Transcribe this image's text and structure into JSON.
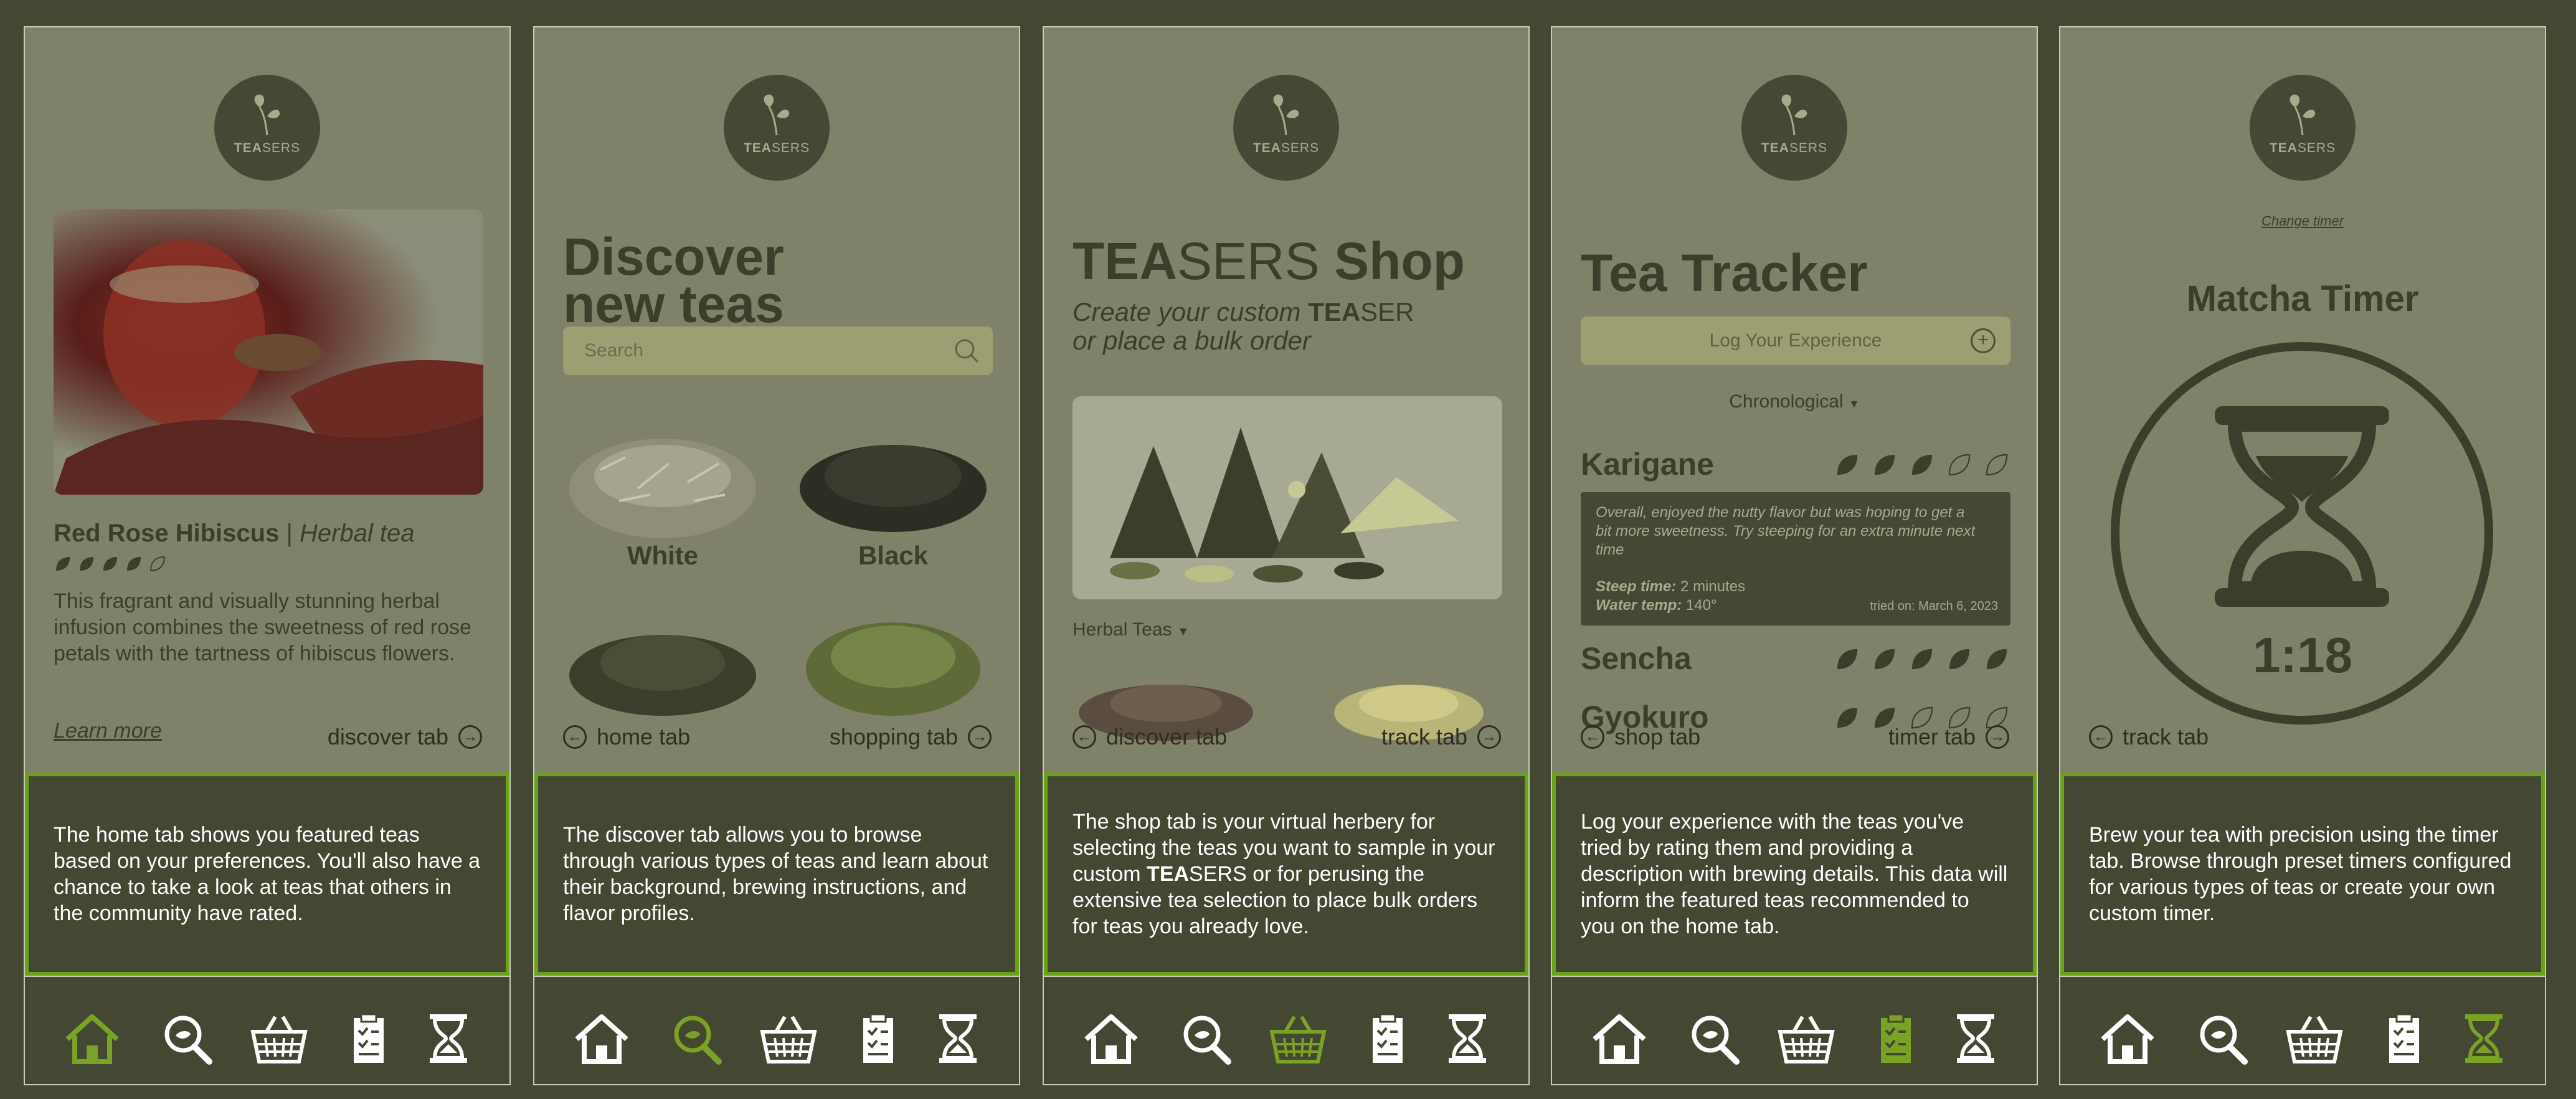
{
  "brand": {
    "logo_text_bold": "TEA",
    "logo_text_light": "SERS"
  },
  "colors": {
    "background": "#444732",
    "screen": "#7f8169",
    "accent": "#69a31a",
    "text_dark": "#3b3e2b",
    "white": "#ffffff"
  },
  "tabbar": {
    "icons": [
      "home-icon",
      "discover-search-icon",
      "shop-basket-icon",
      "tracker-clipboard-icon",
      "timer-hourglass-icon"
    ]
  },
  "panels": [
    {
      "tea_name": "Red Rose Hibiscus",
      "separator": "|",
      "tea_type": "Herbal tea",
      "rating": 4,
      "rating_max": 5,
      "body": "This fragrant and visually stunning herbal infusion combines the sweetness of red rose petals with the tartness of hibiscus flowers.",
      "learn_more": "Learn more",
      "nav_right": "discover tab",
      "description": "The home tab shows you featured teas based on your preferences. You'll also have a chance to take a look at teas that others in the community have rated.",
      "active_tab": "home"
    },
    {
      "title_line1": "Discover",
      "title_line2": "new teas",
      "search_placeholder": "Search",
      "categories": [
        "White",
        "Black"
      ],
      "nav_left": "home tab",
      "nav_right": "shopping tab",
      "description": "The discover tab allows you to browse through various types of teas and learn about their background, brewing instructions, and flavor profiles.",
      "active_tab": "discover"
    },
    {
      "title_bold": "TEA",
      "title_light": "SERS",
      "title_shop": " Shop",
      "subtitle_pre": "Create your custom ",
      "subtitle_bold": "TEA",
      "subtitle_light": "SER",
      "subtitle_line2": "or place a bulk order",
      "filter": "Herbal Teas",
      "nav_left": "discover tab",
      "nav_right": "track tab",
      "description_pre": "The shop tab is your virtual herbery for selecting the teas you want to sample in your custom ",
      "description_bold": "TEA",
      "description_post": "SERS or for perusing the extensive tea selection to place bulk orders for teas you already love.",
      "active_tab": "shop"
    },
    {
      "title": "Tea Tracker",
      "log_button": "Log Your Experience",
      "sort": "Chronological",
      "entries": [
        {
          "name": "Karigane",
          "rating": 3
        },
        {
          "name": "Sencha",
          "rating": 5
        },
        {
          "name": "Gyokuro",
          "rating": 2
        }
      ],
      "note": "Overall, enjoyed the nutty flavor but was hoping to get a bit more sweetness. Try steeping for an extra minute next time",
      "steep_label": "Steep time:",
      "steep_value": "2 minutes",
      "temp_label": "Water temp:",
      "temp_value": "140°",
      "tried_on": "tried on: March 6, 2023",
      "nav_left": "shop tab",
      "nav_right": "timer tab",
      "description": "Log your experience with the teas you've tried by rating them and providing a description with brewing details. This data will inform the featured teas recommended to you on the home tab.",
      "active_tab": "tracker"
    },
    {
      "change_timer": "Change timer",
      "title": "Matcha Timer",
      "time": "1:18",
      "nav_left": "track tab",
      "description": "Brew your tea with precision using the timer tab. Browse through preset timers configured for various types of teas or create your own custom timer.",
      "active_tab": "timer"
    }
  ]
}
